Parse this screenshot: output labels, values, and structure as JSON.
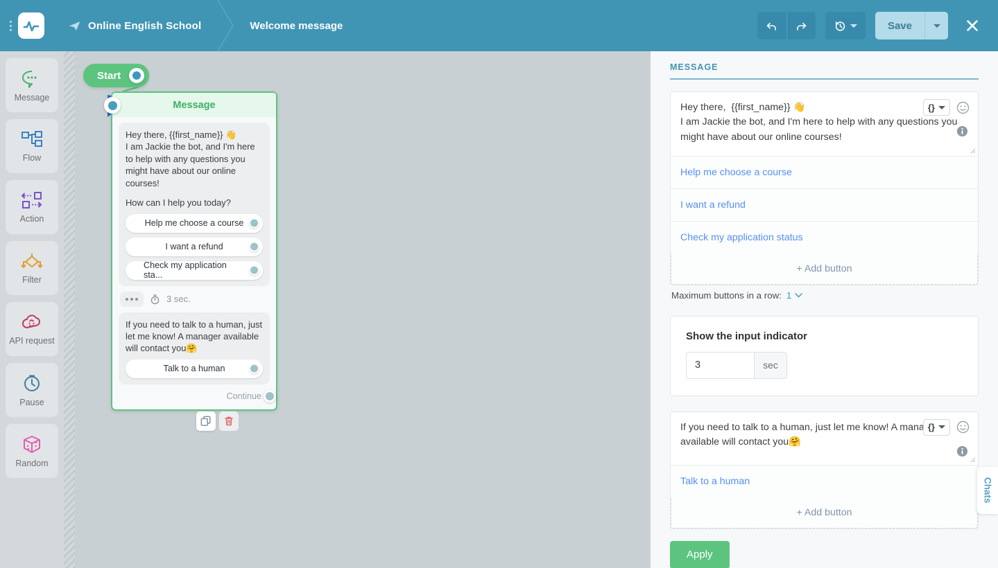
{
  "header": {
    "menu_icon": "kebab-menu-icon",
    "logo_icon": "pulse-logo-icon",
    "channel_icon": "telegram-icon",
    "brand": "Online English School",
    "breadcrumb_current": "Welcome message",
    "undo_icon": "undo-icon",
    "redo_icon": "redo-icon",
    "history_icon": "history-clock-icon",
    "save_label": "Save",
    "close_icon": "close-icon"
  },
  "sidebar": {
    "items": [
      {
        "label": "Message",
        "icon": "chat-bubble-icon",
        "color": "#4caf6e"
      },
      {
        "label": "Flow",
        "icon": "flow-nodes-icon",
        "color": "#3d7fc1"
      },
      {
        "label": "Action",
        "icon": "action-arrows-icon",
        "color": "#7b54c7"
      },
      {
        "label": "Filter",
        "icon": "filter-split-icon",
        "color": "#e39c33"
      },
      {
        "label": "API request",
        "icon": "api-cloud-icon",
        "color": "#c4385e"
      },
      {
        "label": "Pause",
        "icon": "stopwatch-icon",
        "color": "#3f7da0"
      },
      {
        "label": "Random",
        "icon": "dice-cube-icon",
        "color": "#e05fae"
      }
    ]
  },
  "canvas": {
    "start_label": "Start",
    "node": {
      "title": "Message",
      "message_1_line_1": "Hey there,  {{first_name}} 👋",
      "message_1_line_2": "I am Jackie the bot, and I'm here to help with any questions you might have about our online courses!",
      "message_1_question": "How can I help you today?",
      "buttons": [
        "Help me choose a course",
        "I want a refund",
        "Check my application sta..."
      ],
      "delay_value": "3 sec.",
      "typing_icon": "typing-dots-icon",
      "timer_icon": "stopwatch-icon",
      "message_2": "If you need to talk to a human, just let me know! A manager available will contact you🤗",
      "buttons_2": [
        "Talk to a human"
      ],
      "continue_label": "Continue",
      "copy_icon": "copy-icon",
      "delete_icon": "trash-icon"
    }
  },
  "panel": {
    "section_title": "MESSAGE",
    "block_1": {
      "text": "Hey there,  {{first_name}} 👋\nI am Jackie the bot, and I'm here to help with any questions you might have about our online courses!",
      "variable_icon": "curly-braces-icon",
      "emoji_icon": "emoji-smiley-icon",
      "info_icon": "info-icon",
      "buttons": [
        "Help me choose a course",
        "I want a refund",
        "Check my application status"
      ],
      "add_button_label": "+ Add button"
    },
    "max_buttons_label": "Maximum buttons in a row:",
    "max_buttons_value": "1",
    "indicator": {
      "title": "Show the input indicator",
      "value": "3",
      "unit": "sec"
    },
    "block_2": {
      "text": "If you need to talk to a human, just let me know! A manager available will contact you🤗",
      "variable_icon": "curly-braces-icon",
      "emoji_icon": "emoji-smiley-icon",
      "info_icon": "info-icon",
      "buttons": [
        "Talk to a human"
      ],
      "add_button_label": "+ Add button"
    },
    "apply_label": "Apply",
    "chats_tab_label": "Chats"
  },
  "colors": {
    "header_teal": "#4095b5",
    "accent_green": "#5cc47f",
    "link_blue": "#5590f5",
    "section_teal": "#4095b5"
  }
}
